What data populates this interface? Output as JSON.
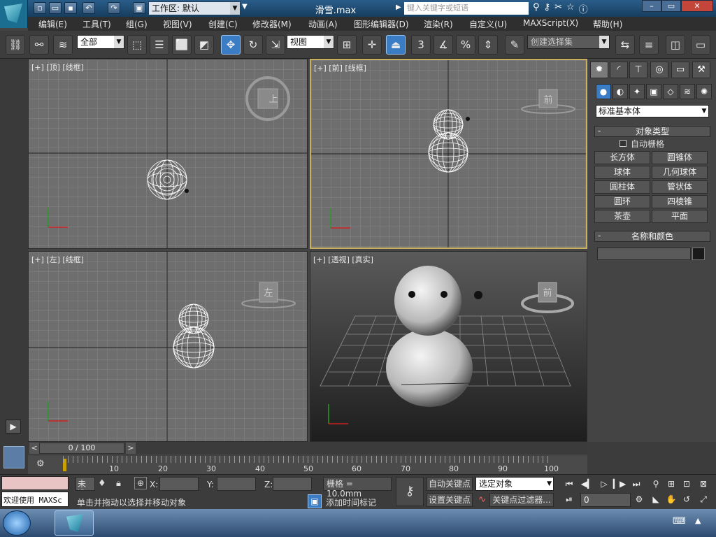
{
  "title": {
    "workspace_label": "工作区: 默认",
    "document": "滑雪.max",
    "search_placeholder": "键入关键字或短语"
  },
  "menu": [
    "编辑(E)",
    "工具(T)",
    "组(G)",
    "视图(V)",
    "创建(C)",
    "修改器(M)",
    "动画(A)",
    "图形编辑器(D)",
    "渲染(R)",
    "自定义(U)",
    "MAXScript(X)",
    "帮助(H)"
  ],
  "toolbar": {
    "selection_filter": "全部",
    "ref_coord": "视图",
    "named_selection_placeholder": "创建选择集",
    "snap_value": "3"
  },
  "viewports": {
    "top": {
      "label": "[+] [顶] [线框]",
      "cube": "上"
    },
    "front": {
      "label": "[+] [前] [线框]",
      "cube": "前"
    },
    "left": {
      "label": "[+] [左] [线框]",
      "cube": "左"
    },
    "persp": {
      "label": "[+] [透视] [真实]",
      "cube": "前"
    }
  },
  "command_panel": {
    "category": "标准基本体",
    "rollout_object_type": "对象类型",
    "auto_grid": "自动栅格",
    "objects": [
      "长方体",
      "圆锥体",
      "球体",
      "几何球体",
      "圆柱体",
      "管状体",
      "圆环",
      "四棱锥",
      "茶壶",
      "平面"
    ],
    "rollout_name_color": "名称和颜色",
    "color": "#1a1a1a"
  },
  "timeline": {
    "frame_display": "0 / 100",
    "ticks": [
      "10",
      "20",
      "30",
      "40",
      "50",
      "60",
      "70",
      "80",
      "90",
      "100"
    ]
  },
  "status": {
    "script_listener": "欢迎使用 MAXSc",
    "unselected": "未选",
    "x_label": "X:",
    "y_label": "Y:",
    "z_label": "Z:",
    "grid": "栅格 = 10.0mm",
    "prompt": "单击并拖动以选择并移动对象",
    "add_time_tag": "添加时间标记",
    "auto_key": "自动关键点",
    "set_key": "设置关键点",
    "key_mode": "选定对象",
    "key_filters": "关键点过滤器...",
    "current_frame": "0"
  },
  "colors": {
    "active_viewport_border": "#c8b060",
    "highlight": "#3b7dc4"
  }
}
